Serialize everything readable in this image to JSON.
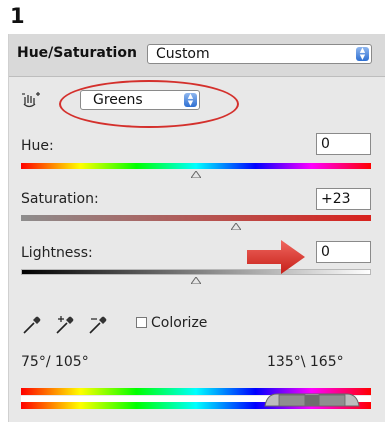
{
  "step": {
    "number": "1"
  },
  "header": {
    "title": "Hue/Saturation",
    "preset": {
      "value": "Custom"
    }
  },
  "channel": {
    "value": "Greens"
  },
  "sliders": {
    "hue": {
      "label": "Hue:",
      "value": "0",
      "fraction": 0.5
    },
    "saturation": {
      "label": "Saturation:",
      "value": "+23",
      "fraction": 0.615
    },
    "lightness": {
      "label": "Lightness:",
      "value": "0",
      "fraction": 0.5
    }
  },
  "tools": {
    "colorize_label": "Colorize",
    "colorize_checked": false
  },
  "range": {
    "left": "75°/ 105°",
    "right": "135°\\ 165°"
  },
  "colors": {
    "annotation_red": "#d4302c",
    "accent_blue": "#2d6fd2"
  },
  "icons": {
    "channel_tool": "hand-adjust-icon",
    "eyedroppers": [
      "eyedropper-icon",
      "eyedropper-plus-icon",
      "eyedropper-minus-icon"
    ],
    "annotation": "red-arrow-icon"
  }
}
